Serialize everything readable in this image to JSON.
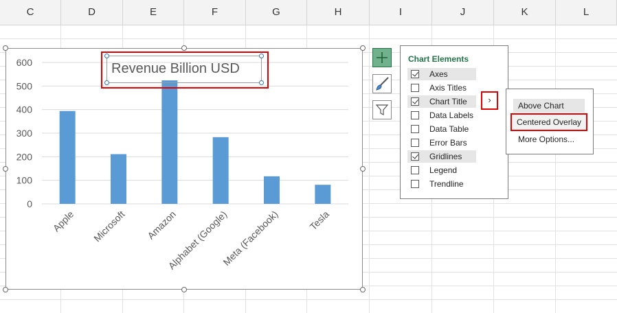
{
  "columns": [
    "C",
    "D",
    "E",
    "F",
    "G",
    "H",
    "I",
    "J",
    "K",
    "L"
  ],
  "chart": {
    "title": "Revenue Billion USD",
    "bar_color": "#5b9bd5",
    "highlight_color": "#e00000"
  },
  "chart_data": {
    "type": "bar",
    "title": "Revenue Billion USD",
    "categories": [
      "Apple",
      "Microsoft",
      "Amazon",
      "Alphabet (Google)",
      "Meta (Facebook)",
      "Tesla"
    ],
    "values": [
      394,
      211,
      524,
      283,
      117,
      81
    ],
    "ylim": [
      0,
      600
    ],
    "yticks": [
      "0",
      "100",
      "200",
      "300",
      "400",
      "500",
      "600"
    ],
    "grid": true,
    "xlabel": "",
    "ylabel": ""
  },
  "toolbar": {
    "elements_button_icon": "plus-icon",
    "styles_button_icon": "paintbrush-icon",
    "filters_button_icon": "funnel-icon"
  },
  "chart_elements_panel": {
    "title": "Chart Elements",
    "items": [
      {
        "label": "Axes",
        "checked": true
      },
      {
        "label": "Axis Titles",
        "checked": false
      },
      {
        "label": "Chart Title",
        "checked": true
      },
      {
        "label": "Data Labels",
        "checked": false
      },
      {
        "label": "Data Table",
        "checked": false
      },
      {
        "label": "Error Bars",
        "checked": false
      },
      {
        "label": "Gridlines",
        "checked": true
      },
      {
        "label": "Legend",
        "checked": false
      },
      {
        "label": "Trendline",
        "checked": false
      }
    ],
    "expand_glyph": "›"
  },
  "submenu": {
    "items": [
      "Above Chart",
      "Centered Overlay",
      "More Options..."
    ]
  }
}
